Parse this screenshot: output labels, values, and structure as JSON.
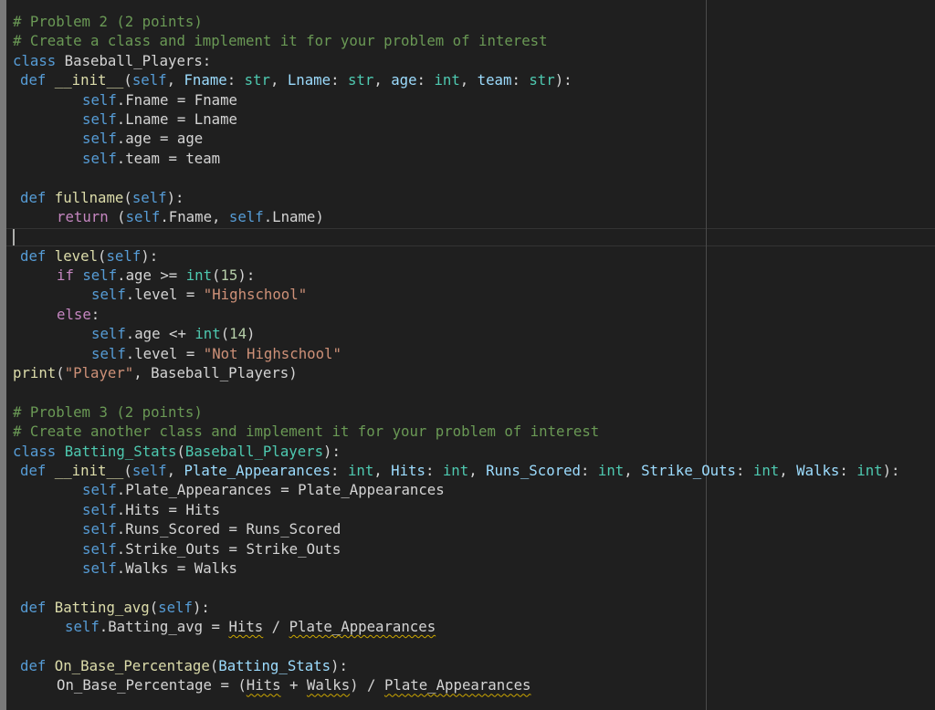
{
  "lines": [
    {
      "indent": 0,
      "tokens": [
        {
          "t": "cm",
          "v": "# Problem 2 (2 points)"
        }
      ]
    },
    {
      "indent": 0,
      "tokens": [
        {
          "t": "cm",
          "v": "# Create a class and implement it for your problem of interest"
        }
      ]
    },
    {
      "indent": 0,
      "tokens": [
        {
          "t": "kw",
          "v": "class"
        },
        {
          "t": "p",
          "v": " Baseball_Players:"
        }
      ]
    },
    {
      "indent": 1,
      "tokens": [
        {
          "t": "kw",
          "v": "def"
        },
        {
          "t": "p",
          "v": " "
        },
        {
          "t": "fn",
          "v": "__init__"
        },
        {
          "t": "p",
          "v": "("
        },
        {
          "t": "sf",
          "v": "self"
        },
        {
          "t": "p",
          "v": ", "
        },
        {
          "t": "var",
          "v": "Fname"
        },
        {
          "t": "p",
          "v": ": "
        },
        {
          "t": "cls",
          "v": "str"
        },
        {
          "t": "p",
          "v": ", "
        },
        {
          "t": "var",
          "v": "Lname"
        },
        {
          "t": "p",
          "v": ": "
        },
        {
          "t": "cls",
          "v": "str"
        },
        {
          "t": "p",
          "v": ", "
        },
        {
          "t": "var",
          "v": "age"
        },
        {
          "t": "p",
          "v": ": "
        },
        {
          "t": "cls",
          "v": "int"
        },
        {
          "t": "p",
          "v": ", "
        },
        {
          "t": "var",
          "v": "team"
        },
        {
          "t": "p",
          "v": ": "
        },
        {
          "t": "cls",
          "v": "str"
        },
        {
          "t": "p",
          "v": "):"
        }
      ]
    },
    {
      "indent": 3,
      "tokens": [
        {
          "t": "sf",
          "v": "self"
        },
        {
          "t": "p",
          "v": ".Fname = Fname"
        }
      ]
    },
    {
      "indent": 3,
      "tokens": [
        {
          "t": "sf",
          "v": "self"
        },
        {
          "t": "p",
          "v": ".Lname = Lname"
        }
      ]
    },
    {
      "indent": 3,
      "tokens": [
        {
          "t": "sf",
          "v": "self"
        },
        {
          "t": "p",
          "v": ".age = age"
        }
      ]
    },
    {
      "indent": 3,
      "tokens": [
        {
          "t": "sf",
          "v": "self"
        },
        {
          "t": "p",
          "v": ".team = team"
        }
      ]
    },
    {
      "indent": 0,
      "tokens": []
    },
    {
      "indent": 1,
      "tokens": [
        {
          "t": "kw",
          "v": "def"
        },
        {
          "t": "p",
          "v": " "
        },
        {
          "t": "fn",
          "v": "fullname"
        },
        {
          "t": "p",
          "v": "("
        },
        {
          "t": "sf",
          "v": "self"
        },
        {
          "t": "p",
          "v": "):"
        }
      ]
    },
    {
      "indent": 2,
      "tokens": [
        {
          "t": "ctl",
          "v": "return"
        },
        {
          "t": "p",
          "v": " ("
        },
        {
          "t": "sf",
          "v": "self"
        },
        {
          "t": "p",
          "v": ".Fname, "
        },
        {
          "t": "sf",
          "v": "self"
        },
        {
          "t": "p",
          "v": ".Lname)"
        }
      ]
    },
    {
      "indent": 0,
      "tokens": []
    },
    {
      "indent": 1,
      "tokens": [
        {
          "t": "kw",
          "v": "def"
        },
        {
          "t": "p",
          "v": " "
        },
        {
          "t": "fn",
          "v": "level"
        },
        {
          "t": "p",
          "v": "("
        },
        {
          "t": "sf",
          "v": "self"
        },
        {
          "t": "p",
          "v": "):"
        }
      ]
    },
    {
      "indent": 2,
      "tokens": [
        {
          "t": "ctl",
          "v": "if"
        },
        {
          "t": "p",
          "v": " "
        },
        {
          "t": "sf",
          "v": "self"
        },
        {
          "t": "p",
          "v": ".age >= "
        },
        {
          "t": "cls",
          "v": "int"
        },
        {
          "t": "p",
          "v": "("
        },
        {
          "t": "num",
          "v": "15"
        },
        {
          "t": "p",
          "v": "):"
        }
      ]
    },
    {
      "indent": 4,
      "tokens": [
        {
          "t": "sf",
          "v": "self"
        },
        {
          "t": "p",
          "v": ".level = "
        },
        {
          "t": "str",
          "v": "\"Highschool\""
        }
      ]
    },
    {
      "indent": 2,
      "tokens": [
        {
          "t": "ctl",
          "v": "else"
        },
        {
          "t": "p",
          "v": ":"
        }
      ]
    },
    {
      "indent": 4,
      "tokens": [
        {
          "t": "sf",
          "v": "self"
        },
        {
          "t": "p",
          "v": ".age <+ "
        },
        {
          "t": "cls",
          "v": "int"
        },
        {
          "t": "p",
          "v": "("
        },
        {
          "t": "num",
          "v": "14"
        },
        {
          "t": "p",
          "v": ")"
        }
      ]
    },
    {
      "indent": 4,
      "tokens": [
        {
          "t": "sf",
          "v": "self"
        },
        {
          "t": "p",
          "v": ".level = "
        },
        {
          "t": "str",
          "v": "\"Not Highschool\""
        }
      ]
    },
    {
      "indent": 0,
      "tokens": [
        {
          "t": "fn",
          "v": "print"
        },
        {
          "t": "p",
          "v": "("
        },
        {
          "t": "str",
          "v": "\"Player\""
        },
        {
          "t": "p",
          "v": ", Baseball_Players)"
        }
      ]
    },
    {
      "indent": 0,
      "tokens": []
    },
    {
      "indent": 0,
      "tokens": [
        {
          "t": "cm",
          "v": "# Problem 3 (2 points)"
        }
      ]
    },
    {
      "indent": 0,
      "tokens": [
        {
          "t": "cm",
          "v": "# Create another class and implement it for your problem of interest"
        }
      ]
    },
    {
      "indent": 0,
      "tokens": [
        {
          "t": "kw",
          "v": "class"
        },
        {
          "t": "p",
          "v": " "
        },
        {
          "t": "cls",
          "v": "Batting_Stats"
        },
        {
          "t": "p",
          "v": "("
        },
        {
          "t": "cls",
          "v": "Baseball_Players"
        },
        {
          "t": "p",
          "v": "):"
        }
      ]
    },
    {
      "indent": 1,
      "tokens": [
        {
          "t": "kw",
          "v": "def"
        },
        {
          "t": "p",
          "v": " "
        },
        {
          "t": "fn",
          "v": "__init__"
        },
        {
          "t": "p",
          "v": "("
        },
        {
          "t": "sf",
          "v": "self"
        },
        {
          "t": "p",
          "v": ", "
        },
        {
          "t": "var",
          "v": "Plate_Appearances"
        },
        {
          "t": "p",
          "v": ": "
        },
        {
          "t": "cls",
          "v": "int"
        },
        {
          "t": "p",
          "v": ", "
        },
        {
          "t": "var",
          "v": "Hits"
        },
        {
          "t": "p",
          "v": ": "
        },
        {
          "t": "cls",
          "v": "int"
        },
        {
          "t": "p",
          "v": ", "
        },
        {
          "t": "var",
          "v": "Runs_Scored"
        },
        {
          "t": "p",
          "v": ": "
        },
        {
          "t": "cls",
          "v": "int"
        },
        {
          "t": "p",
          "v": ", "
        },
        {
          "t": "var",
          "v": "Strike_Outs"
        },
        {
          "t": "p",
          "v": ": "
        },
        {
          "t": "cls",
          "v": "int"
        },
        {
          "t": "p",
          "v": ", "
        },
        {
          "t": "var",
          "v": "Walks"
        },
        {
          "t": "p",
          "v": ": "
        },
        {
          "t": "cls",
          "v": "int"
        },
        {
          "t": "p",
          "v": "):"
        }
      ]
    },
    {
      "indent": 3,
      "tokens": [
        {
          "t": "sf",
          "v": "self"
        },
        {
          "t": "p",
          "v": ".Plate_Appearances = Plate_Appearances"
        }
      ]
    },
    {
      "indent": 3,
      "tokens": [
        {
          "t": "sf",
          "v": "self"
        },
        {
          "t": "p",
          "v": ".Hits = Hits"
        }
      ]
    },
    {
      "indent": 3,
      "tokens": [
        {
          "t": "sf",
          "v": "self"
        },
        {
          "t": "p",
          "v": ".Runs_Scored = Runs_Scored"
        }
      ]
    },
    {
      "indent": 3,
      "tokens": [
        {
          "t": "sf",
          "v": "self"
        },
        {
          "t": "p",
          "v": ".Strike_Outs = Strike_Outs"
        }
      ]
    },
    {
      "indent": 3,
      "tokens": [
        {
          "t": "sf",
          "v": "self"
        },
        {
          "t": "p",
          "v": ".Walks = Walks"
        }
      ]
    },
    {
      "indent": 0,
      "tokens": []
    },
    {
      "indent": 1,
      "tokens": [
        {
          "t": "kw",
          "v": "def"
        },
        {
          "t": "p",
          "v": " "
        },
        {
          "t": "fn",
          "v": "Batting_avg"
        },
        {
          "t": "p",
          "v": "("
        },
        {
          "t": "sf",
          "v": "self"
        },
        {
          "t": "p",
          "v": "):"
        }
      ]
    },
    {
      "indent": 5,
      "tokens": [
        {
          "t": "sf",
          "v": "self"
        },
        {
          "t": "p",
          "v": ".Batting_avg = "
        },
        {
          "t": "p sq",
          "v": "Hits"
        },
        {
          "t": "p",
          "v": " / "
        },
        {
          "t": "p sq",
          "v": "Plate_Appearances"
        }
      ]
    },
    {
      "indent": 0,
      "tokens": []
    },
    {
      "indent": 1,
      "tokens": [
        {
          "t": "kw",
          "v": "def"
        },
        {
          "t": "p",
          "v": " "
        },
        {
          "t": "fn",
          "v": "On_Base_Percentage"
        },
        {
          "t": "p",
          "v": "("
        },
        {
          "t": "var",
          "v": "Batting_Stats"
        },
        {
          "t": "p",
          "v": "):"
        }
      ]
    },
    {
      "indent": 2,
      "tokens": [
        {
          "t": "p",
          "v": "On_Base_Percentage = ("
        },
        {
          "t": "p sq",
          "v": "Hits"
        },
        {
          "t": "p",
          "v": " + "
        },
        {
          "t": "p sq",
          "v": "Walks"
        },
        {
          "t": "p",
          "v": ") / "
        },
        {
          "t": "p sq",
          "v": "Plate_Appearances"
        }
      ]
    }
  ]
}
